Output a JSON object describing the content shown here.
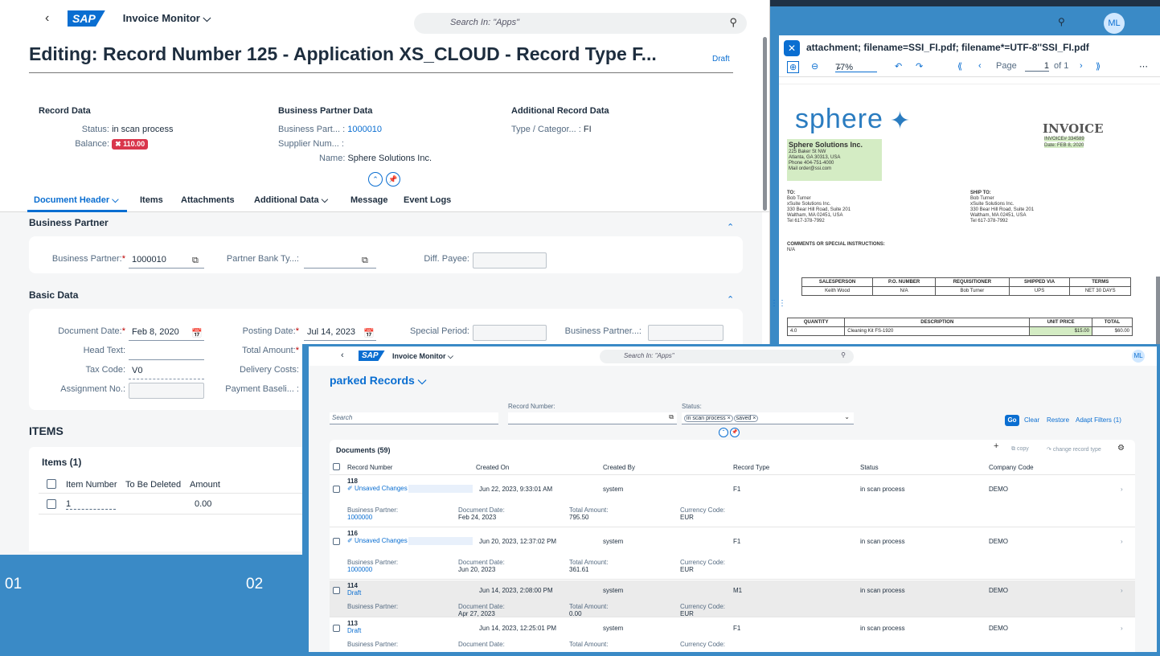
{
  "screen1": {
    "app_title": "Invoice Monitor ⌵",
    "search_placeholder": "Search In: \"Apps\"",
    "page_title": "Editing: Record Number 125 - Application XS_CLOUD - Record Type F...",
    "draft": "Draft",
    "header_groups": {
      "record_data": {
        "title": "Record Data",
        "status_label": "Status:",
        "status_value": "in scan process",
        "balance_label": "Balance:",
        "balance_value": "110.00"
      },
      "bp_data": {
        "title": "Business Partner Data",
        "bp_label": "Business Part... :",
        "bp_value": "1000010",
        "supplier_label": "Supplier Num... :",
        "name_label": "Name:",
        "name_value": "Sphere Solutions Inc."
      },
      "additional": {
        "title": "Additional Record Data",
        "type_label": "Type / Categor... :",
        "type_value": "FI"
      }
    },
    "tabs": [
      "Document Header ⌵",
      "Items",
      "Attachments",
      "Additional Data ⌵",
      "Message",
      "Event Logs"
    ],
    "bp_section": {
      "title": "Business Partner",
      "bp_label": "Business Partner:",
      "bp_value": "1000010",
      "bank_label": "Partner Bank Ty...:",
      "payee_label": "Diff. Payee:"
    },
    "basic_section": {
      "title": "Basic Data",
      "doc_date_label": "Document Date:",
      "doc_date_value": "Feb 8, 2020",
      "posting_label": "Posting Date:",
      "posting_value": "Jul 14, 2023",
      "special_label": "Special Period:",
      "bp_label": "Business Partner...:",
      "head_text_label": "Head Text:",
      "total_label": "Total Amount:",
      "tax_label": "Tax Code:",
      "tax_value": "V0",
      "delivery_label": "Delivery Costs:",
      "assign_label": "Assignment No.:",
      "payment_label": "Payment Baseli... :"
    },
    "items": {
      "title": "ITEMS",
      "subtitle": "Items (1)",
      "columns": [
        "Item Number",
        "To Be Deleted",
        "Amount"
      ],
      "row": {
        "item": "1",
        "amount": "0.00"
      }
    }
  },
  "screen2": {
    "attachment_name": "attachment; filename=SSI_FI.pdf; filename*=UTF-8''SSI_FI.pdf",
    "zoom": "77%",
    "page_label": "Page",
    "page_value": "1",
    "page_of": "of 1",
    "bell": "🔔",
    "avatar": "ML",
    "pdf": {
      "logo": "sphere",
      "invoice_title": "INVOICE",
      "invoice_no": "INVOICE# 334589",
      "invoice_date": "Date: FEB 8, 2020",
      "company": "Sphere Solutions Inc.",
      "company_addr": [
        "225 Baker St NW",
        "Atlanta, GA 30313, USA",
        "Phone 404-751-4000",
        "Mail order@ssi.com"
      ],
      "to_title": "TO:",
      "to_addr": [
        "Bob Turner",
        "xSuite Solutions Inc.",
        "330 Bear Hill Road, Suite 201",
        "Waltham, MA 02451, USA",
        "Tel 617-378-7992"
      ],
      "ship_title": "SHIP TO:",
      "ship_addr": [
        "Bob Turner",
        "xSuite Solutions Inc.",
        "330 Bear Hill Road, Suite 201",
        "Waltham, MA 02451, USA",
        "Tel 617-378-7992"
      ],
      "comments_title": "COMMENTS OR SPECIAL INSTRUCTIONS:",
      "comments_value": "N/A",
      "t1_head": [
        "SALESPERSON",
        "P.O. NUMBER",
        "REQUISITIONER",
        "SHIPPED VIA",
        "TERMS"
      ],
      "t1_row": [
        "Keith Wood",
        "N/A",
        "Bob Turner",
        "UPS",
        "NET 30 DAYS"
      ],
      "t2_head": [
        "QUANTITY",
        "DESCRIPTION",
        "UNIT PRICE",
        "TOTAL"
      ],
      "t2_row": [
        "4.0",
        "Cleaning Kit FS-1920",
        "$15.00",
        "$60.00"
      ]
    }
  },
  "screen3": {
    "app_title": "Invoice Monitor ⌵",
    "search_placeholder": "Search In: \"Apps\"",
    "avatar": "ML",
    "title": "parked Records ⌵",
    "record_number_label": "Record Number:",
    "status_label": "Status:",
    "search_placeholder2": "Search",
    "tokens": [
      "in scan process ×",
      "saved ×"
    ],
    "go": "Go",
    "clear": "Clear",
    "restore": "Restore",
    "adapt": "Adapt Filters (1)",
    "documents_title": "Documents (59)",
    "copy": "copy",
    "change_type": "change record type",
    "columns": [
      "Record Number",
      "Created On",
      "Created By",
      "Record Type",
      "Status",
      "Company Code"
    ],
    "rows": [
      {
        "num": "118",
        "sub": "Unsaved Changes by",
        "created": "Jun 22, 2023, 9:33:01 AM",
        "by": "system",
        "type": "F1",
        "status": "in scan process",
        "company": "DEMO",
        "bp": "1000000",
        "doc_date": "Feb 24, 2023",
        "total": "795.50",
        "currency": "EUR"
      },
      {
        "num": "116",
        "sub": "Unsaved Changes by",
        "created": "Jun 20, 2023, 12:37:02 PM",
        "by": "system",
        "type": "F1",
        "status": "in scan process",
        "company": "DEMO",
        "bp": "1000000",
        "doc_date": "Jun 20, 2023",
        "total": "361.61",
        "currency": "EUR"
      },
      {
        "num": "114",
        "sub": "Draft",
        "created": "Jun 14, 2023, 2:08:00 PM",
        "by": "system",
        "type": "M1",
        "status": "in scan process",
        "company": "DEMO",
        "bp": "",
        "doc_date": "Apr 27, 2023",
        "total": "0.00",
        "currency": "EUR"
      },
      {
        "num": "113",
        "sub": "Draft",
        "created": "Jun 14, 2023, 12:25:01 PM",
        "by": "system",
        "type": "F1",
        "status": "in scan process",
        "company": "DEMO",
        "bp": "",
        "doc_date": "",
        "total": "",
        "currency": ""
      }
    ],
    "detail_labels": {
      "bp": "Business Partner:",
      "doc_date": "Document Date:",
      "total": "Total Amount:",
      "currency": "Currency Code:"
    }
  },
  "labels": {
    "num1": "01",
    "num2": "02"
  }
}
